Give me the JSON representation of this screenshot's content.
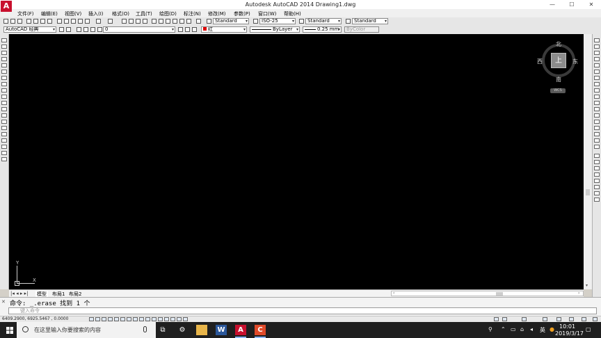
{
  "window": {
    "title": "Autodesk AutoCAD 2014    Drawing1.dwg",
    "logo_letter": "A",
    "minimize": "—",
    "maximize": "☐",
    "close": "✕"
  },
  "menu": [
    "文件(F)",
    "编辑(E)",
    "视图(V)",
    "插入(I)",
    "格式(O)",
    "工具(T)",
    "绘图(D)",
    "标注(N)",
    "修改(M)",
    "参数(P)",
    "窗口(W)",
    "帮助(H)"
  ],
  "toolbar": {
    "text_style": "Standard",
    "dim_style": "ISO-25",
    "table_style": "Standard",
    "mleader_style": "Standard",
    "workspace": "AutoCAD 经典",
    "layer": "0",
    "color": "红",
    "linetype": "ByLayer",
    "lineweight": "0.25 mm",
    "plot_style": "ByColor",
    "color_swatch": "#e00000"
  },
  "viewcube": {
    "north": "北",
    "south": "南",
    "east": "东",
    "west": "西",
    "face": "上",
    "wcs": "WCS"
  },
  "ucs": {
    "y": "Y",
    "x": "X"
  },
  "tabs": {
    "nav": "|◂ ◂ ▸ ▸|",
    "model": "模型",
    "layout1": "布局1",
    "layout2": "布局2"
  },
  "command": {
    "history": "命令: _.erase 找到 1 个",
    "placeholder": "键入命令"
  },
  "status": {
    "coords": "6409.2900, 6925.5467 , 0.0000"
  },
  "taskbar": {
    "search_placeholder": "在这里输入你要搜索的内容",
    "time": "10:01",
    "date": "2019/3/17",
    "ime": "英",
    "word_letter": "W",
    "autocad_letter": "A",
    "other_letter": "C"
  }
}
